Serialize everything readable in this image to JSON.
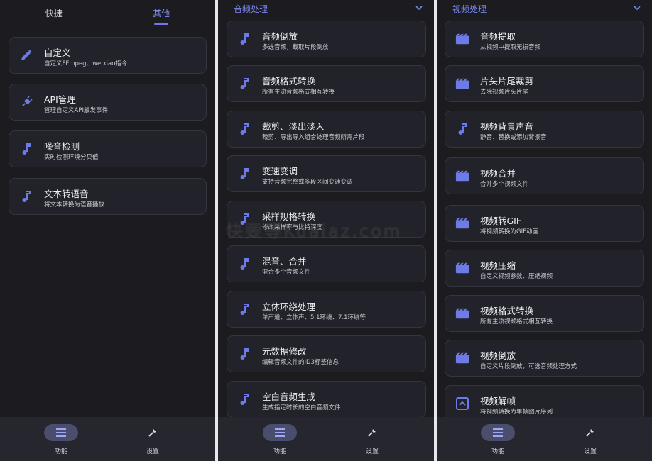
{
  "colors": {
    "panel_bg": "#1c1c20",
    "card_bg": "#22232a",
    "accent": "#7f8cf0",
    "nav_bg": "#25262e"
  },
  "panel1": {
    "tabs": [
      {
        "label": "快捷"
      },
      {
        "label": "其他",
        "active": true
      }
    ],
    "cards": [
      {
        "title": "自定义",
        "subtitle": "自定义FFmpeg、weixiao指令",
        "icon": "pencil-icon"
      },
      {
        "title": "API管理",
        "subtitle": "管理自定义API触发事件",
        "icon": "plug-icon"
      },
      {
        "title": "噪音检测",
        "subtitle": "实时检测环境分贝值",
        "icon": "music-note-icon"
      },
      {
        "title": "文本转语音",
        "subtitle": "将文本转换为语音播放",
        "icon": "music-note-icon"
      }
    ]
  },
  "panel2": {
    "section_title": "音频处理",
    "cards": [
      {
        "title": "音频倒放",
        "subtitle": "多选音频，截取片段倒放",
        "icon": "music-note-icon"
      },
      {
        "title": "音频格式转换",
        "subtitle": "所有主流音频格式相互转换",
        "icon": "music-note-icon"
      },
      {
        "title": "裁剪、淡出淡入",
        "subtitle": "裁剪、导出导入组合处理音频所需片段",
        "icon": "music-note-icon"
      },
      {
        "title": "变速变调",
        "subtitle": "支持音频完整或多段区间变速变调",
        "icon": "music-note-icon"
      },
      {
        "title": "采样规格转换",
        "subtitle": "修改采样率与比特深度",
        "icon": "music-note-icon"
      },
      {
        "title": "混音、合并",
        "subtitle": "混合多个音频文件",
        "icon": "music-note-icon"
      },
      {
        "title": "立体环绕处理",
        "subtitle": "单声道、立体声、5.1环绕、7.1环绕等",
        "icon": "music-note-icon"
      },
      {
        "title": "元数据修改",
        "subtitle": "编辑音频文件的ID3标签信息",
        "icon": "music-note-icon"
      },
      {
        "title": "空白音频生成",
        "subtitle": "生成指定时长的空白音频文件",
        "icon": "music-note-icon"
      }
    ]
  },
  "panel3": {
    "section_title": "视频处理",
    "cards": [
      {
        "title": "音频提取",
        "subtitle": "从视频中提取无损音频",
        "icon": "clapperboard-icon"
      },
      {
        "title": "片头片尾裁剪",
        "subtitle": "去除视频片头片尾",
        "icon": "clapperboard-icon"
      },
      {
        "title": "视频背景声音",
        "subtitle": "静音、替换或添加背景音",
        "icon": "music-note-icon"
      },
      {
        "title": "视频合并",
        "subtitle": "合并多个视频文件",
        "icon": "clapperboard-icon"
      },
      {
        "title": "视频转GIF",
        "subtitle": "将视频转换为GIF动画",
        "icon": "clapperboard-icon"
      },
      {
        "title": "视频压缩",
        "subtitle": "自定义视频参数、压缩视频",
        "icon": "clapperboard-icon"
      },
      {
        "title": "视频格式转换",
        "subtitle": "所有主流视频格式相互转换",
        "icon": "clapperboard-icon"
      },
      {
        "title": "视频倒放",
        "subtitle": "自定义片段倒放，可选音频处理方式",
        "icon": "clapperboard-icon"
      },
      {
        "title": "视频解帧",
        "subtitle": "将视频转换为单帧图片序列",
        "icon": "frame-icon"
      }
    ]
  },
  "nav": [
    {
      "label": "功能",
      "icon": "list-icon",
      "active": true
    },
    {
      "label": "设置",
      "icon": "wrench-icon"
    }
  ],
  "watermark": "快要等Kuaiaz.com"
}
